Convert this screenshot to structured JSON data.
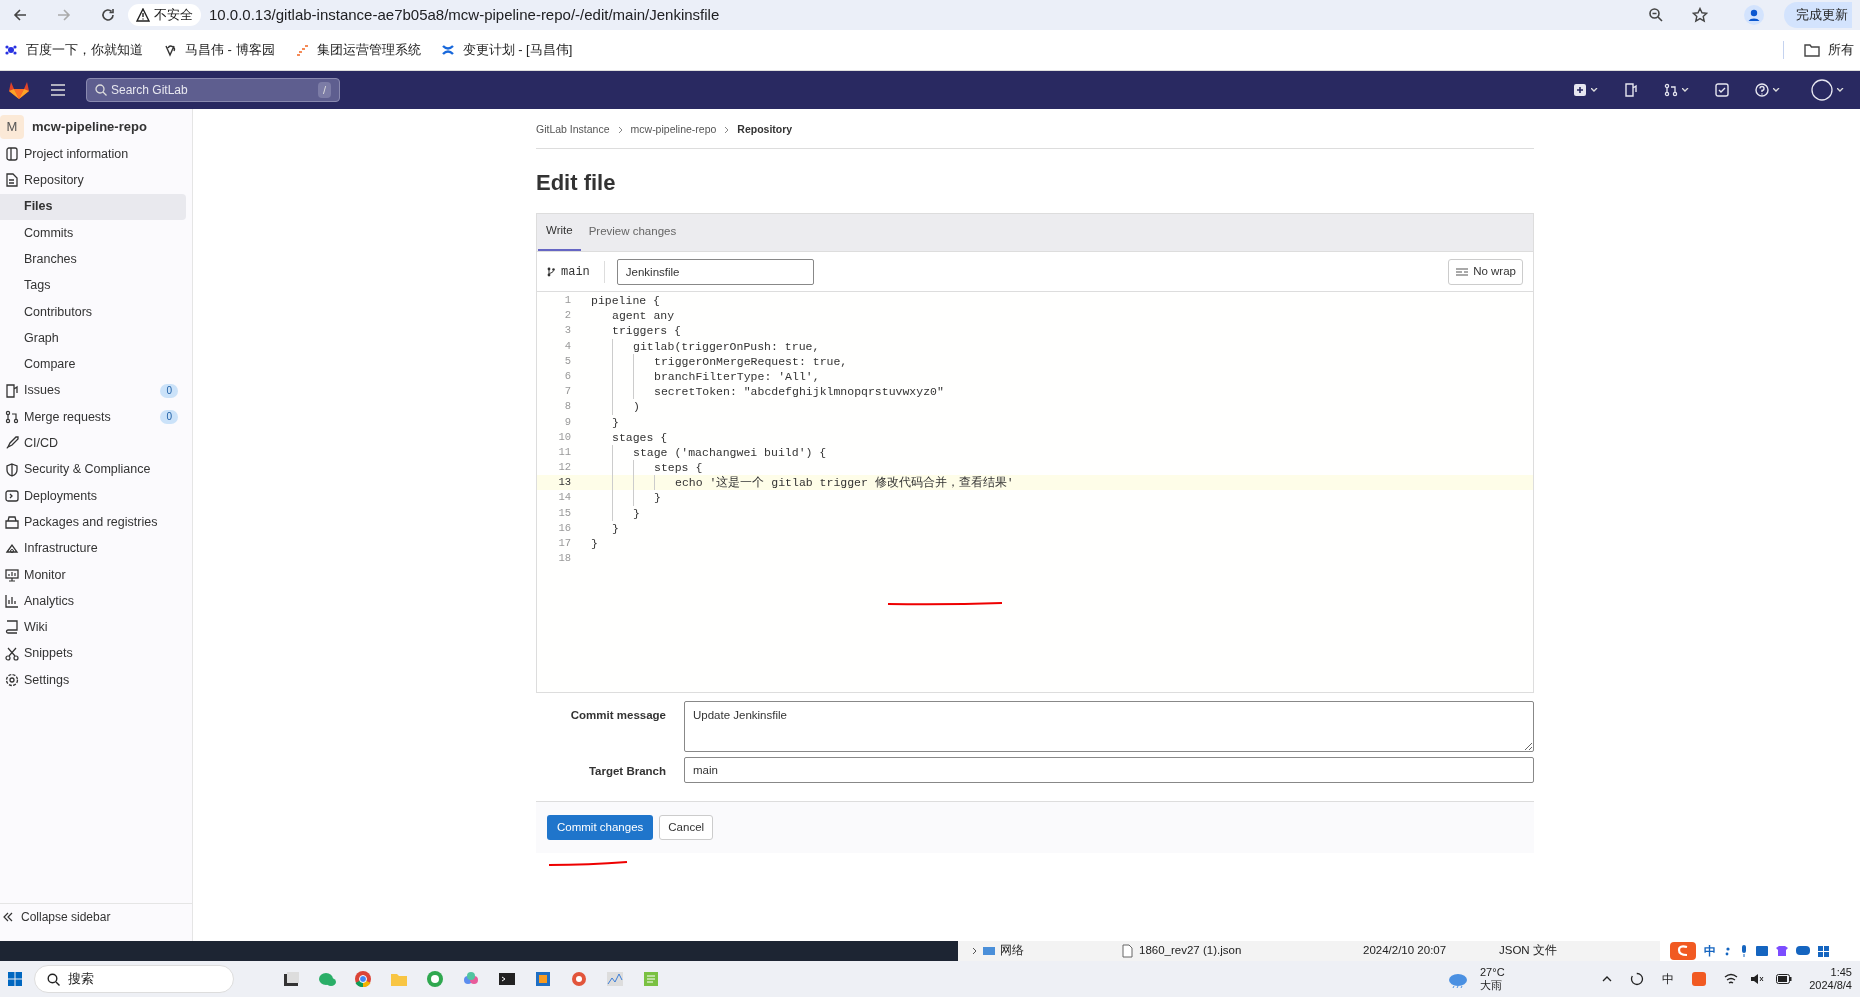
{
  "browser": {
    "security": "不安全",
    "url": "10.0.0.13/gitlab-instance-ae7b05a8/mcw-pipeline-repo/-/edit/main/Jenkinsfile",
    "update_button": "完成更新",
    "bookmarks": [
      "百度一下，你就知道",
      "马昌伟 - 博客园",
      "集团运营管理系统",
      "变更计划 - [马昌伟]"
    ],
    "all_bookmarks": "所有"
  },
  "topbar": {
    "search_placeholder": "Search GitLab",
    "search_shortcut": "/"
  },
  "sidebar": {
    "project_initial": "M",
    "project_name": "mcw-pipeline-repo",
    "items": [
      {
        "kind": "section",
        "label": "Project information",
        "selected": false
      },
      {
        "kind": "section",
        "label": "Repository",
        "selected": false
      },
      {
        "kind": "sub",
        "label": "Files",
        "selected": true
      },
      {
        "kind": "sub",
        "label": "Commits",
        "selected": false
      },
      {
        "kind": "sub",
        "label": "Branches",
        "selected": false
      },
      {
        "kind": "sub",
        "label": "Tags",
        "selected": false
      },
      {
        "kind": "sub",
        "label": "Contributors",
        "selected": false
      },
      {
        "kind": "sub",
        "label": "Graph",
        "selected": false
      },
      {
        "kind": "sub",
        "label": "Compare",
        "selected": false
      },
      {
        "kind": "section",
        "label": "Issues",
        "count": "0",
        "selected": false
      },
      {
        "kind": "section",
        "label": "Merge requests",
        "count": "0",
        "selected": false
      },
      {
        "kind": "section",
        "label": "CI/CD",
        "selected": false
      },
      {
        "kind": "section",
        "label": "Security & Compliance",
        "selected": false
      },
      {
        "kind": "section",
        "label": "Deployments",
        "selected": false
      },
      {
        "kind": "section",
        "label": "Packages and registries",
        "selected": false
      },
      {
        "kind": "section",
        "label": "Infrastructure",
        "selected": false
      },
      {
        "kind": "section",
        "label": "Monitor",
        "selected": false
      },
      {
        "kind": "section",
        "label": "Analytics",
        "selected": false
      },
      {
        "kind": "section",
        "label": "Wiki",
        "selected": false
      },
      {
        "kind": "section",
        "label": "Snippets",
        "selected": false
      },
      {
        "kind": "section",
        "label": "Settings",
        "selected": false
      }
    ],
    "collapse": "Collapse sidebar"
  },
  "breadcrumbs": [
    "GitLab Instance",
    "mcw-pipeline-repo",
    "Repository"
  ],
  "title": "Edit file",
  "tabs": [
    {
      "label": "Write",
      "selected": true
    },
    {
      "label": "Preview changes",
      "selected": false
    }
  ],
  "branch": "main",
  "file_name": "Jenkinsfile",
  "wrap_button": "No wrap",
  "code_lines": [
    {
      "number": "1",
      "text": "pipeline {",
      "current": false
    },
    {
      "number": "2",
      "text": "    agent any",
      "current": false
    },
    {
      "number": "3",
      "text": "    triggers {",
      "current": false
    },
    {
      "number": "4",
      "text": "        gitlab(triggerOnPush: true,",
      "current": false
    },
    {
      "number": "5",
      "text": "            triggerOnMergeRequest: true,",
      "current": false
    },
    {
      "number": "6",
      "text": "            branchFilterType: 'All',",
      "current": false
    },
    {
      "number": "7",
      "text": "            secretToken: \"abcdefghijklmnopqrstuvwxyz0\"",
      "current": false
    },
    {
      "number": "8",
      "text": "        )",
      "current": false
    },
    {
      "number": "9",
      "text": "    }",
      "current": false
    },
    {
      "number": "10",
      "text": "    stages {",
      "current": false
    },
    {
      "number": "11",
      "text": "        stage ('machangwei build') {",
      "current": false
    },
    {
      "number": "12",
      "text": "            steps {",
      "current": false
    },
    {
      "number": "13",
      "text": "                echo '这是一个 gitlab trigger 修改代码合并，查看结果'",
      "current": true
    },
    {
      "number": "14",
      "text": "            }",
      "current": false
    },
    {
      "number": "15",
      "text": "        }",
      "current": false
    },
    {
      "number": "16",
      "text": "    }",
      "current": false
    },
    {
      "number": "17",
      "text": "}",
      "current": false
    },
    {
      "number": "18",
      "current": false
    }
  ],
  "commit_message": {
    "label": "Commit message",
    "value": "Update Jenkinsfile"
  },
  "target_branch": {
    "label": "Target Branch",
    "value": "main"
  },
  "buttons": [
    "Commit changes",
    "Cancel"
  ],
  "background_window": {
    "item": "网络",
    "file": "1860_rev27 (1).json",
    "date": "2024/2/10 20:07",
    "type": "JSON 文件"
  },
  "ime_bar": {
    "mode": "中"
  },
  "taskbar": {
    "search": "搜索",
    "temperature": "27°C",
    "weather": "大雨",
    "ime": "中",
    "time": "1:45",
    "date": "2024/8/4"
  }
}
